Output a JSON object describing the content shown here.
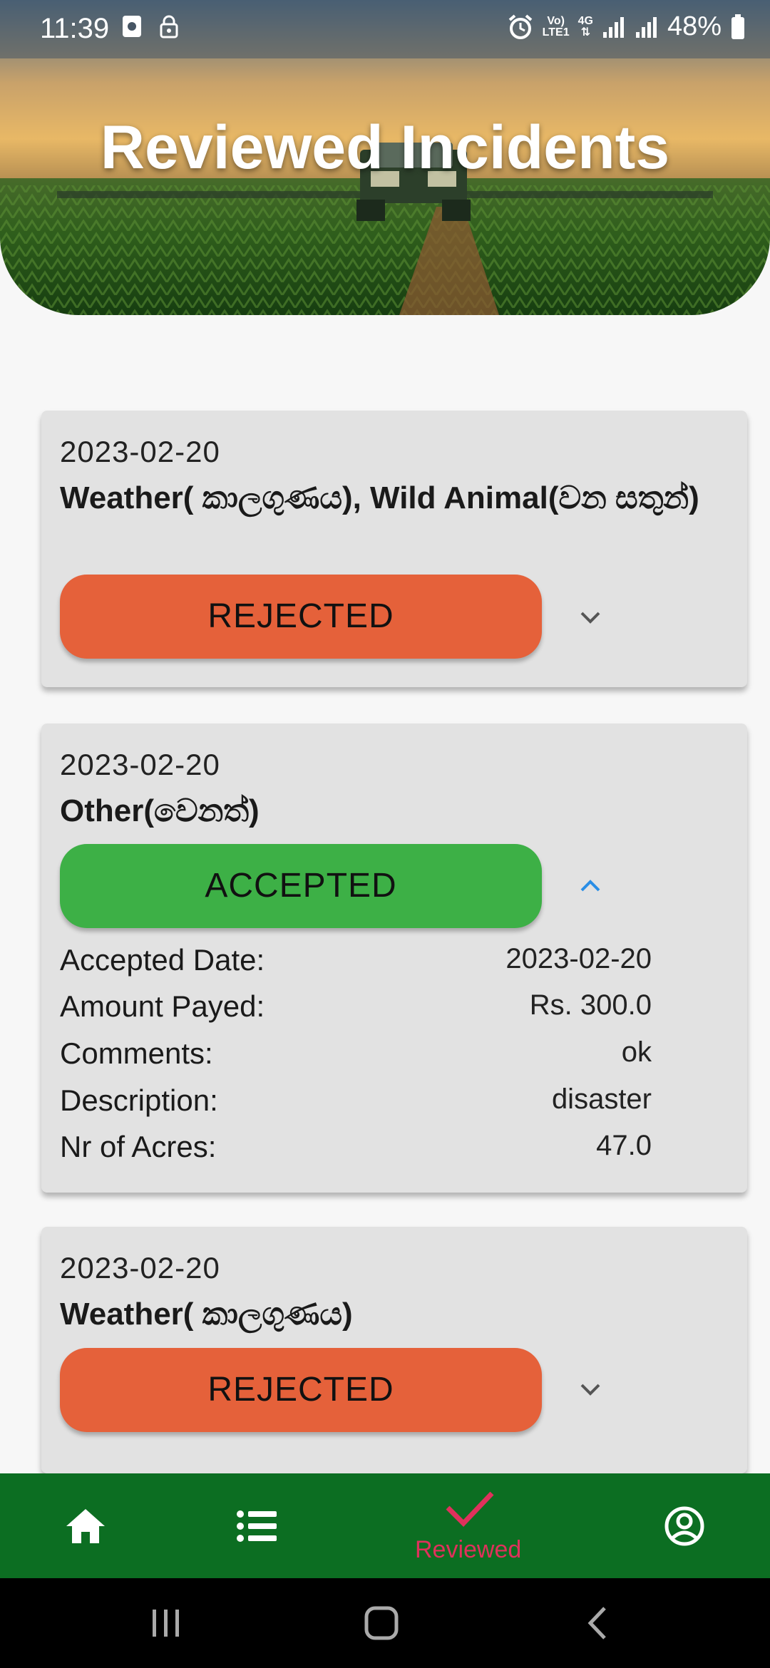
{
  "status_bar": {
    "time": "11:39",
    "network_top": "Vo)",
    "network_bottom": "LTE1",
    "network_type": "4G",
    "battery": "48%",
    "icons": [
      "media-icon",
      "lock-icon",
      "alarm-icon",
      "signal-icon",
      "battery-icon"
    ]
  },
  "header": {
    "title": "Reviewed Incidents"
  },
  "incidents": [
    {
      "date": "2023-02-20",
      "category": "Weather( කාලගුණය), Wild Animal(වන සතුන්)",
      "status": "REJECTED",
      "expanded": false
    },
    {
      "date": "2023-02-20",
      "category": "Other(වෙනත්)",
      "status": "ACCEPTED",
      "expanded": true,
      "details": [
        {
          "label": "Accepted Date:",
          "value": "2023-02-20"
        },
        {
          "label": "Amount Payed:",
          "value": "Rs. 300.0"
        },
        {
          "label": "Comments:",
          "value": "ok"
        },
        {
          "label": "Description:",
          "value": "disaster"
        },
        {
          "label": "Nr of Acres:",
          "value": "47.0"
        }
      ]
    },
    {
      "date": "2023-02-20",
      "category": "Weather( කාලගුණය)",
      "status": "REJECTED",
      "expanded": false
    }
  ],
  "bottom_nav": {
    "items": [
      {
        "icon": "home-icon",
        "label": ""
      },
      {
        "icon": "list-icon",
        "label": ""
      },
      {
        "icon": "check-icon",
        "label": "Reviewed",
        "active": true
      },
      {
        "icon": "profile-icon",
        "label": ""
      }
    ]
  },
  "colors": {
    "rejected": "#e5613a",
    "accepted": "#3db046",
    "nav_bg": "#0c6e22",
    "nav_active": "#e0315c",
    "card_bg": "#e2e2e2",
    "chevron_expanded": "#2a8ee6"
  }
}
